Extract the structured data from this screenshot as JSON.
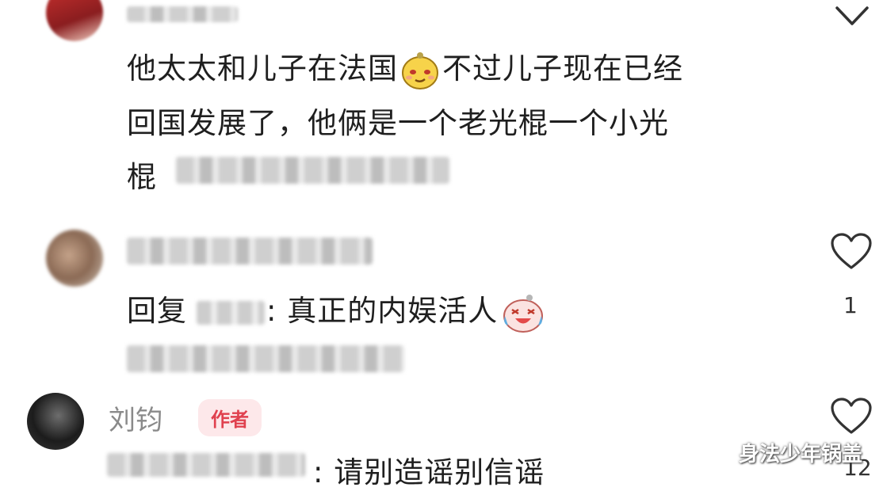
{
  "comments": [
    {
      "text_lines": [
        "他太太和儿子在法国",
        "不过儿子现在已经",
        "回国发展了，他俩是一个老光棍一个小光",
        "棍"
      ]
    },
    {
      "reply_prefix": "回复",
      "reply_text": ": 真正的内娱活人",
      "likes": "1"
    },
    {
      "author_name": "刘钧",
      "badge": "作者",
      "reply_text": ": 请别造谣别信谣",
      "likes": "12"
    }
  ],
  "icons": {
    "collapse": "chevron-down-icon",
    "like": "heart-outline-icon"
  },
  "watermark": "身法少年锅盖",
  "colors": {
    "badge_bg": "#fde8ea",
    "badge_text": "#e0414f"
  }
}
